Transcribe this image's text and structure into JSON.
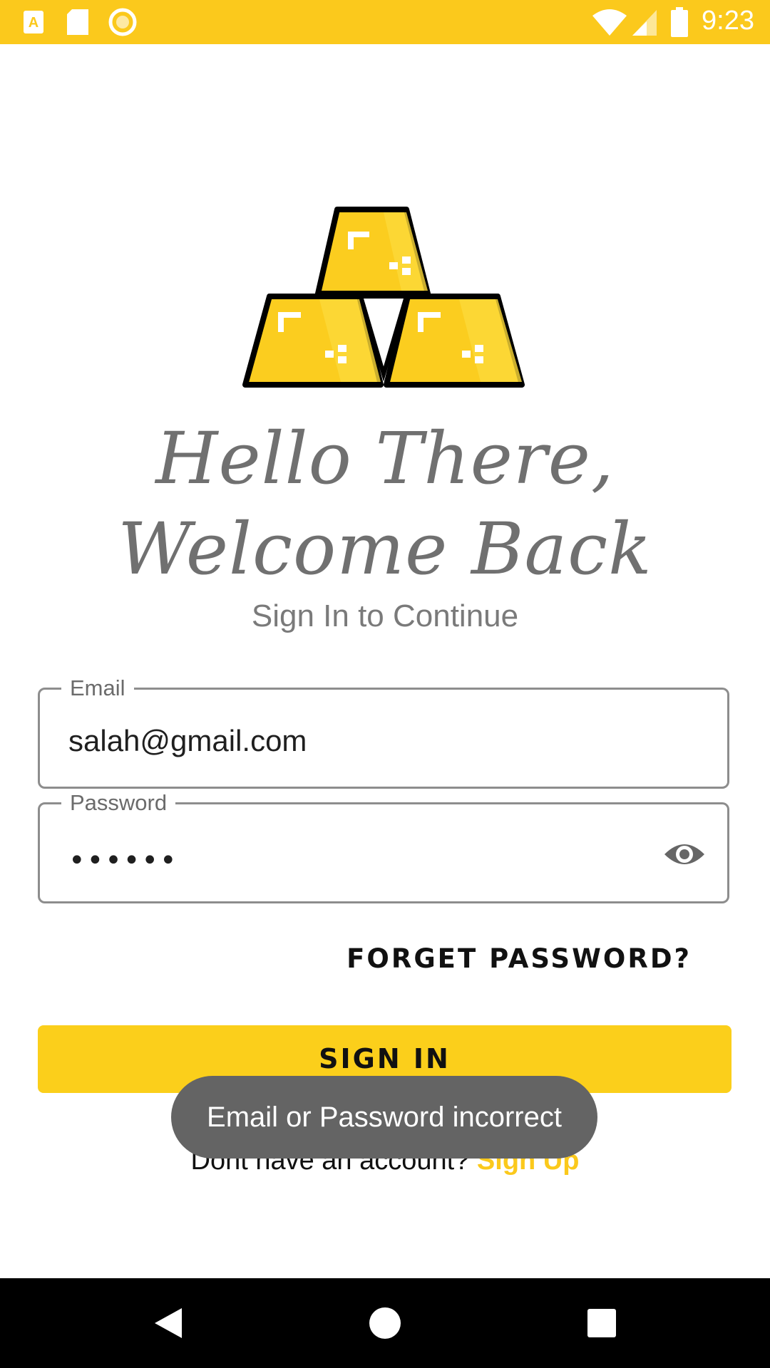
{
  "status_bar": {
    "time": "9:23",
    "colors": {
      "background": "#FBC91C"
    },
    "icons": [
      "app-a-icon",
      "sd-card-icon",
      "sync-circle-icon",
      "wifi-icon",
      "signal-icon",
      "battery-icon"
    ]
  },
  "header": {
    "line1": "Hello There,",
    "line2": "Welcome Back",
    "subtitle": "Sign In to Continue"
  },
  "form": {
    "email_label": "Email",
    "email_value": "salah@gmail.com",
    "password_label": "Password",
    "password_value": "••••••",
    "forget_label": "FORGET PASSWORD?",
    "signin_label": "SIGN IN",
    "no_account_text": "Dont have an account? ",
    "signup_label": "Sign Up"
  },
  "toast": {
    "message": "Email or Password incorrect"
  },
  "nav": {
    "icons": [
      "back-icon",
      "home-icon",
      "recents-icon"
    ]
  },
  "colors": {
    "accent": "#FBC91C",
    "toast_bg": "#646464"
  }
}
